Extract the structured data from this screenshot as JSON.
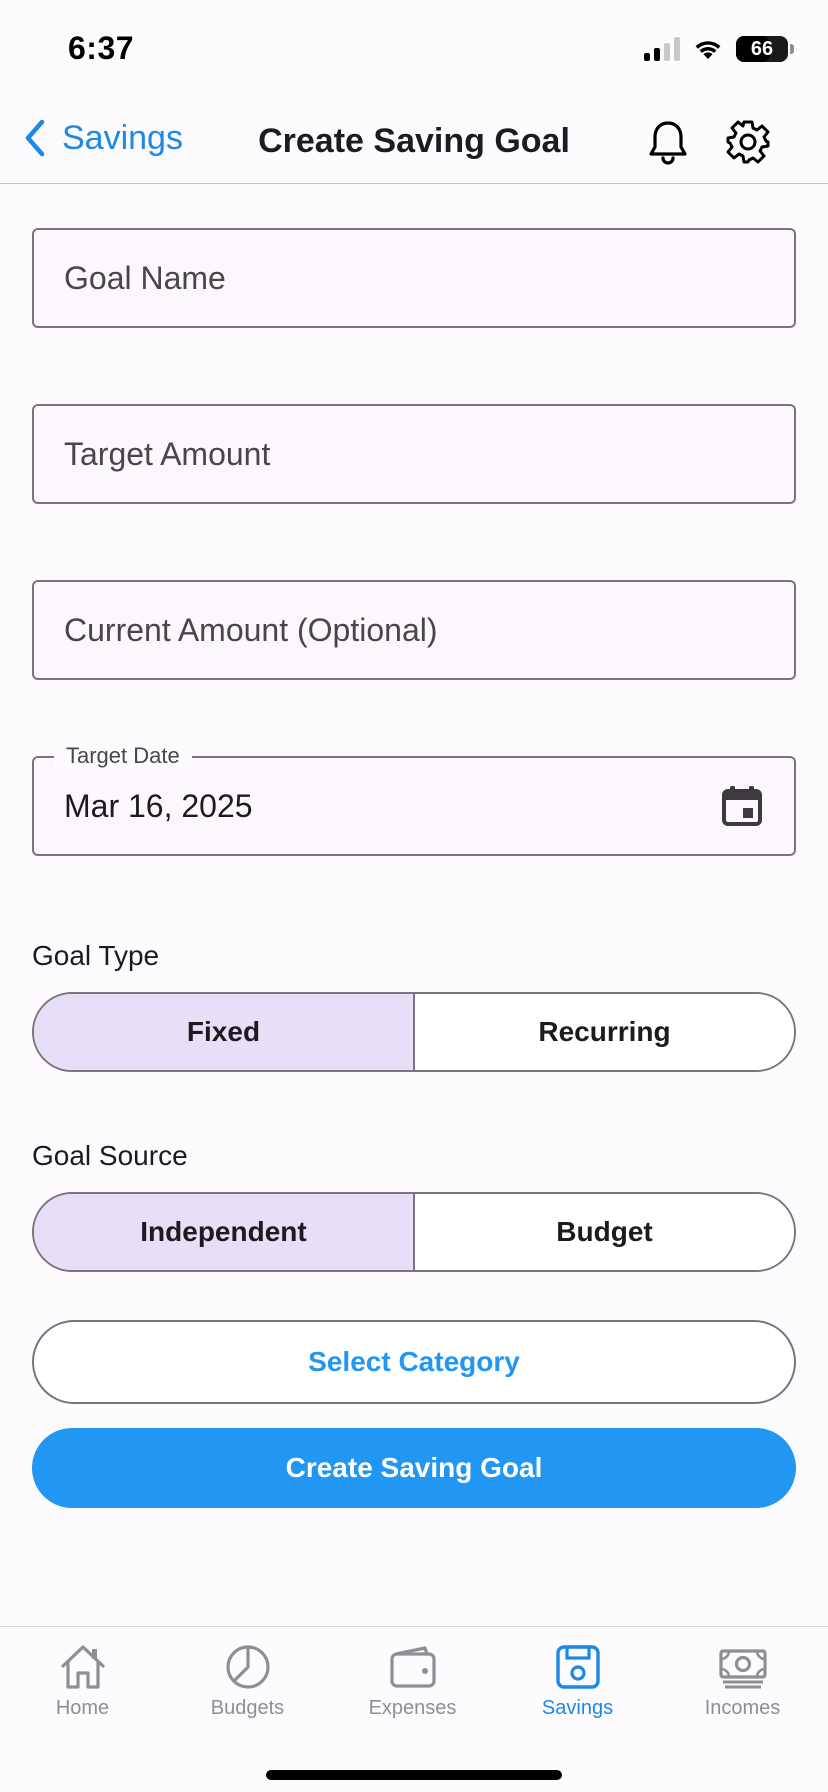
{
  "status_bar": {
    "time": "6:37",
    "battery": "66",
    "battery_level": 0.66
  },
  "nav": {
    "back_label": "Savings",
    "title": "Create Saving Goal",
    "icons": [
      "bell-icon",
      "gear-icon"
    ]
  },
  "form": {
    "goal_name_placeholder": "Goal Name",
    "target_amount_placeholder": "Target Amount",
    "current_amount_placeholder": "Current Amount (Optional)",
    "target_date_label": "Target Date",
    "target_date_value": "Mar 16, 2025",
    "goal_type_label": "Goal Type",
    "goal_type_options": [
      "Fixed",
      "Recurring"
    ],
    "goal_type_selected": "Fixed",
    "goal_source_label": "Goal Source",
    "goal_source_options": [
      "Independent",
      "Budget"
    ],
    "goal_source_selected": "Independent",
    "select_category_label": "Select Category",
    "create_button_label": "Create Saving Goal"
  },
  "tabs": [
    {
      "label": "Home",
      "icon": "home-icon",
      "active": false
    },
    {
      "label": "Budgets",
      "icon": "pie-chart-icon",
      "active": false
    },
    {
      "label": "Expenses",
      "icon": "wallet-icon",
      "active": false
    },
    {
      "label": "Savings",
      "icon": "floppy-disk-icon",
      "active": true
    },
    {
      "label": "Incomes",
      "icon": "banknote-icon",
      "active": false
    }
  ],
  "colors": {
    "accent": "#2196f3",
    "ios_blue": "#1e88e5",
    "segment_selected": "#e8def8",
    "field_background": "#fdf7fd",
    "outline": "#79747e"
  }
}
